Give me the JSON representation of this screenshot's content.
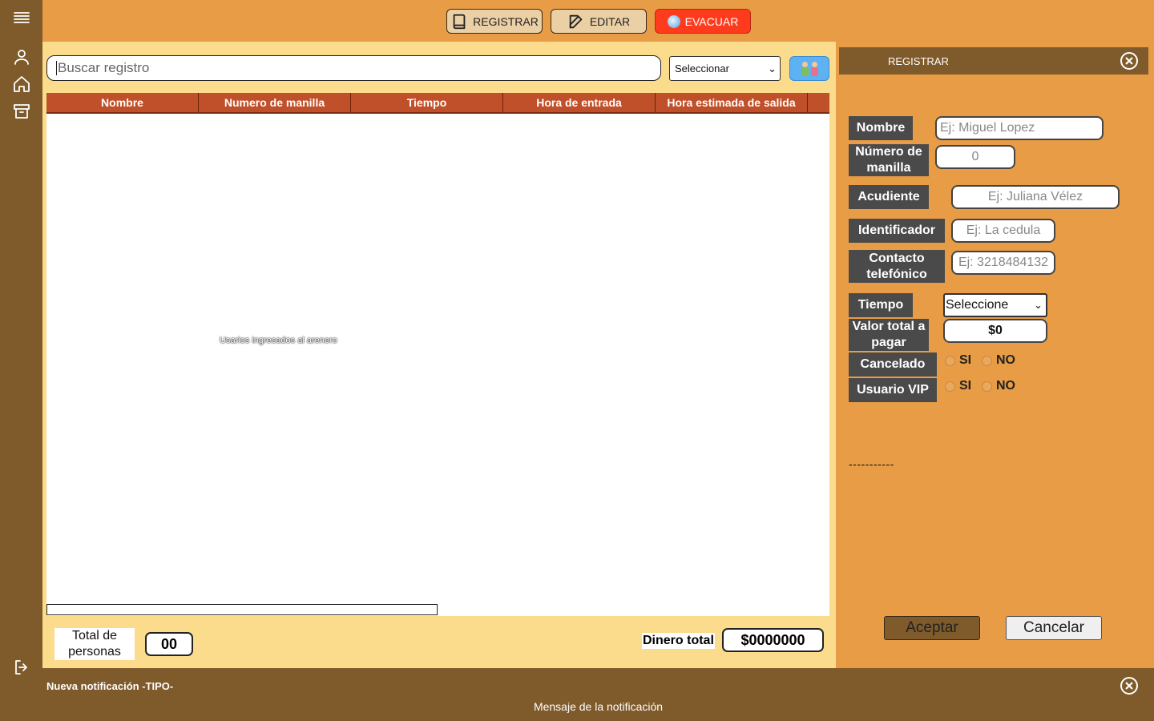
{
  "topbar": {
    "register_label": "REGISTRAR",
    "edit_label": "EDITAR",
    "evacuate_label": "EVACUAR"
  },
  "search": {
    "placeholder": "Buscar registro"
  },
  "filter_select": {
    "value": "Seleccionar"
  },
  "table": {
    "columns": [
      "Nombre",
      "Numero de manilla",
      "Tiempo",
      "Hora de entrada",
      "Hora estimada de salida"
    ],
    "rows": [],
    "empty_message": "Usarios ingresados al arenero"
  },
  "footer": {
    "total_people_label": "Total de personas",
    "total_people_value": "00",
    "money_label": "Dinero total",
    "money_value": "$0000000"
  },
  "register_panel": {
    "title": "REGISTRAR",
    "fields": {
      "nombre_label": "Nombre",
      "nombre_placeholder": "Ej: Miguel Lopez",
      "manilla_label": "Número de manilla",
      "manilla_value": "0",
      "acudiente_label": "Acudiente",
      "acudiente_placeholder": "Ej: Juliana Vélez",
      "identificador_label": "Identificador",
      "identificador_placeholder": "Ej: La cedula",
      "contacto_label": "Contacto telefónico",
      "contacto_placeholder": "Ej: 3218484132",
      "tiempo_label": "Tiempo",
      "tiempo_value": "Seleccione",
      "valor_label": "Valor total a pagar",
      "valor_value": "$0",
      "cancelado_label": "Cancelado",
      "vip_label": "Usuario VIP",
      "yes": "SI",
      "no": "NO"
    },
    "divider_text": "-----------",
    "accept_label": "Aceptar",
    "cancel_label": "Cancelar"
  },
  "notification": {
    "title": "Nueva notificación -TIPO-",
    "message": "Mensaje de la notificación"
  },
  "colors": {
    "background": "#E79C45",
    "sidebar": "#7F5A2B",
    "table_header": "#C0502A",
    "main_panel": "#FBDB8C",
    "evacuate": "#FF3B1E",
    "label_box": "#4A4A4A"
  }
}
